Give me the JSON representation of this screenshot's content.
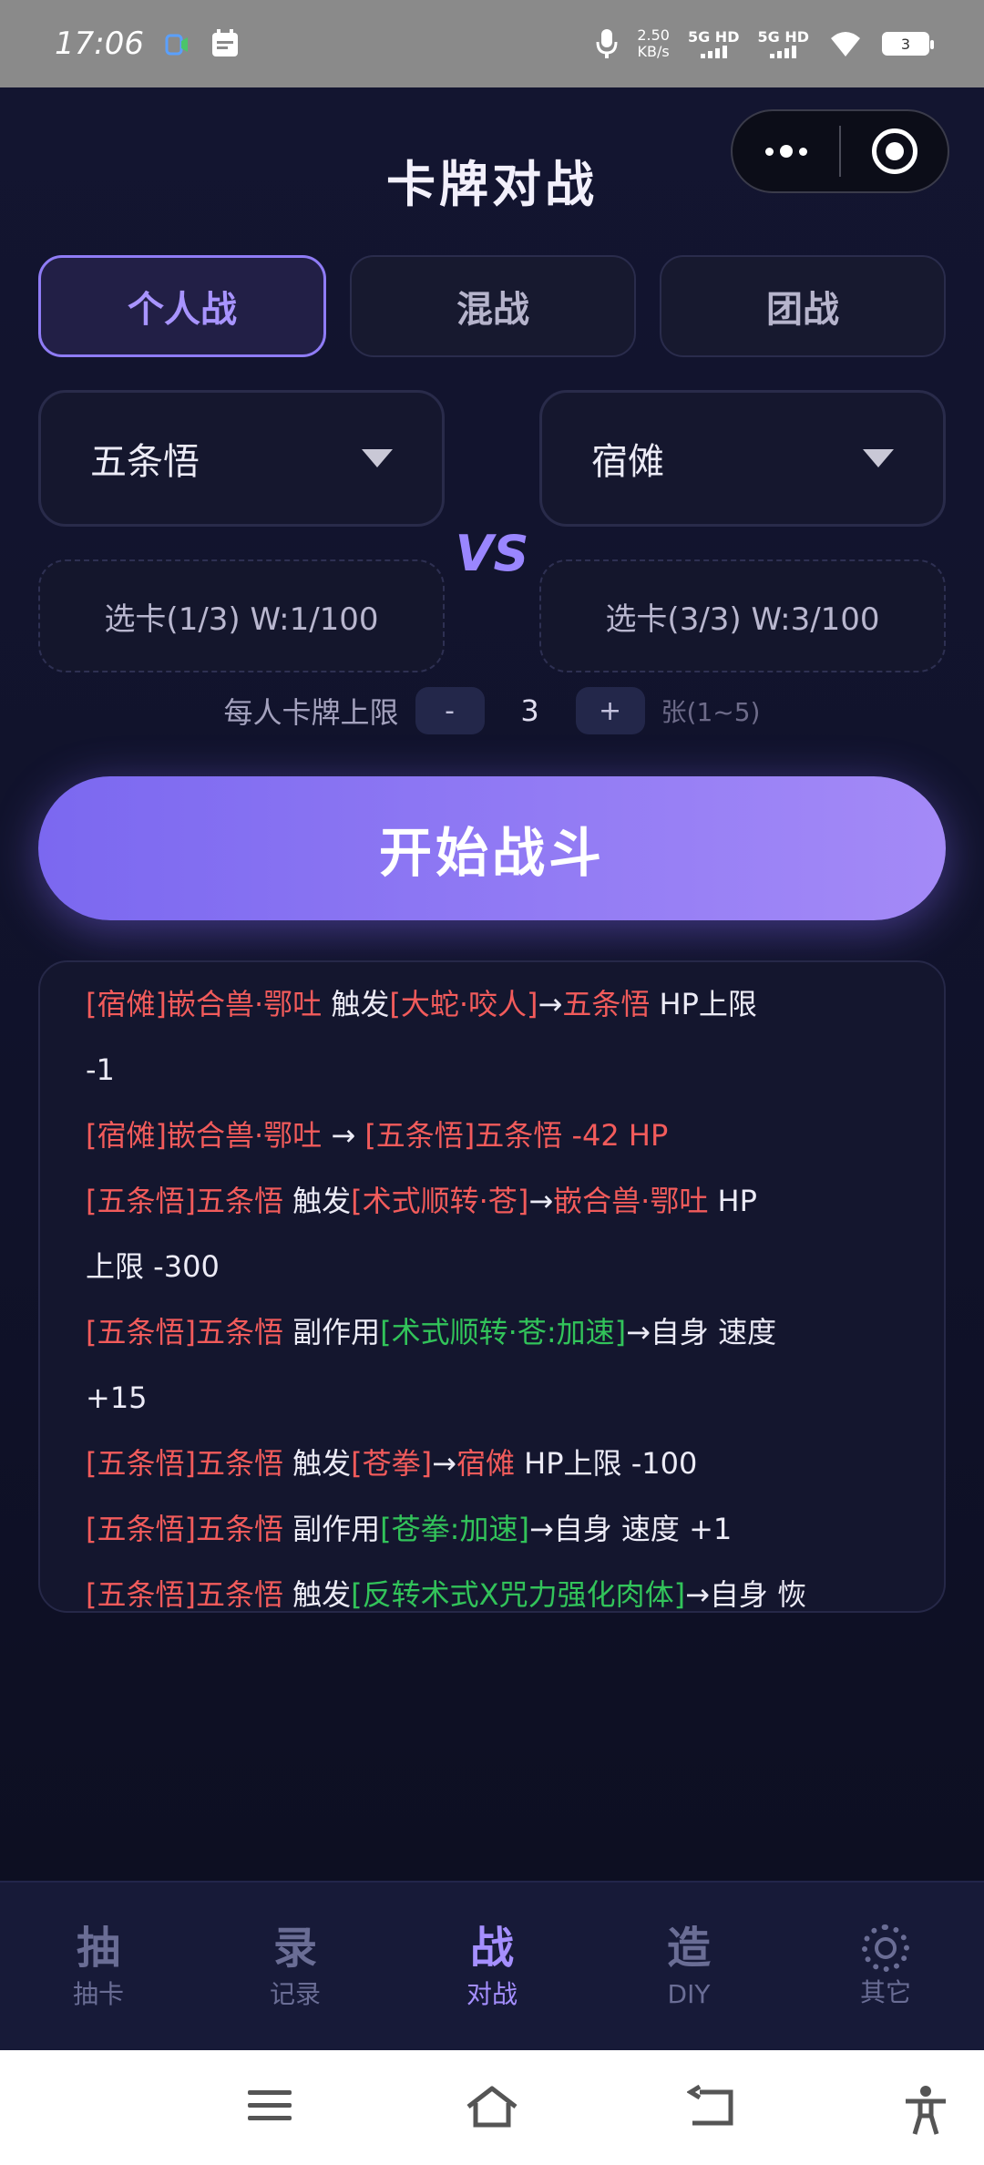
{
  "status_bar": {
    "time": "17:06",
    "net_speed_value": "2.50",
    "net_speed_unit": "KB/s",
    "signal1": "5G HD",
    "signal2": "5G HD",
    "battery": "3"
  },
  "header": {
    "title": "卡牌对战"
  },
  "tabs": [
    {
      "label": "个人战",
      "active": true
    },
    {
      "label": "混战",
      "active": false
    },
    {
      "label": "团战",
      "active": false
    }
  ],
  "players": {
    "left": {
      "name": "五条悟",
      "card_pick": "选卡(1/3) W:1/100"
    },
    "right": {
      "name": "宿傩",
      "card_pick": "选卡(3/3) W:3/100"
    },
    "vs": "VS"
  },
  "card_limit": {
    "label": "每人卡牌上限",
    "minus": "-",
    "value": "3",
    "plus": "+",
    "unit": "张(1~5)"
  },
  "start_button": "开始战斗",
  "log": {
    "line1": {
      "a": "[宿傩]嵌合兽·鄂吐",
      "b": " 触发",
      "c": "[大蛇·咬人]",
      "d": "→",
      "e": "五条悟",
      "f": " HP上限"
    },
    "line2": "-1",
    "line3": {
      "a": "[宿傩]嵌合兽·鄂吐",
      "b": " → ",
      "c": "[五条悟]五条悟",
      "d": " -42 HP"
    },
    "line4": {
      "a": "[五条悟]五条悟",
      "b": " 触发",
      "c": "[术式顺转·苍]",
      "d": "→",
      "e": "嵌合兽·鄂吐",
      "f": " HP"
    },
    "line5": "上限 -300",
    "line6": {
      "a": "[五条悟]五条悟",
      "b": " 副作用",
      "c": "[术式顺转·苍:加速]",
      "d": "→自身 速度"
    },
    "line7": "+15",
    "line8": {
      "a": "[五条悟]五条悟",
      "b": " 触发",
      "c": "[苍拳]",
      "d": "→",
      "e": "宿傩",
      "f": " HP上限 -100"
    },
    "line9": {
      "a": "[五条悟]五条悟",
      "b": " 副作用",
      "c": "[苍拳:加速]",
      "d": "→自身 速度 +1"
    },
    "line10": {
      "a": "[五条悟]五条悟",
      "b": " 触发",
      "c": "[反转术式X咒力强化肉体]",
      "d": "→自身 恢"
    }
  },
  "bottom_nav": [
    {
      "glyph": "抽",
      "label": "抽卡",
      "active": false
    },
    {
      "glyph": "录",
      "label": "记录",
      "active": false
    },
    {
      "glyph": "战",
      "label": "对战",
      "active": true
    },
    {
      "glyph": "造",
      "label": "DIY",
      "active": false
    },
    {
      "glyph": "gear-icon",
      "label": "其它",
      "active": false
    }
  ],
  "colors": {
    "accent": "#8f7cf6",
    "log_red": "#f25b5b",
    "log_green": "#32c35a",
    "background": "#0f1126"
  }
}
